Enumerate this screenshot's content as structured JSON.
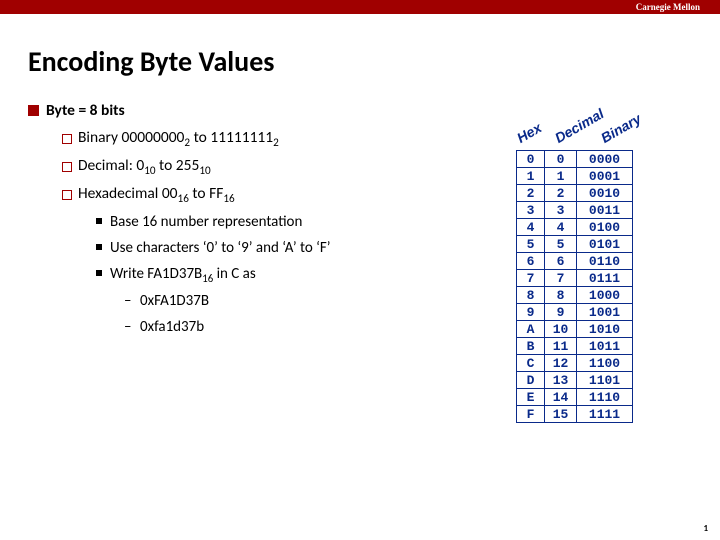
{
  "header": {
    "org": "Carnegie Mellon"
  },
  "title": "Encoding Byte Values",
  "bullets": {
    "byte": "Byte = 8 bits",
    "binary_pre": "Binary 00000000",
    "binary_sub1": "2",
    "binary_mid": " to 11111111",
    "binary_sub2": "2",
    "decimal_pre": "Decimal: 0",
    "decimal_sub1": "10",
    "decimal_mid": " to 255",
    "decimal_sub2": "10",
    "hex_pre": "Hexadecimal 00",
    "hex_sub1": "16",
    "hex_mid": " to FF",
    "hex_sub2": "16",
    "base16": "Base 16 number representation",
    "chars": "Use characters ‘0’ to ‘9’ and ‘A’ to ‘F’",
    "write_pre": "Write FA1D37B",
    "write_sub": "16",
    "write_post": " in C as",
    "ex1": "0xFA1D37B",
    "ex2": "0xfa1d37b"
  },
  "table_headers": {
    "hex": "Hex",
    "dec": "Decimal",
    "bin": "Binary"
  },
  "chart_data": {
    "type": "table",
    "title": "Hex / Decimal / Binary byte nibble values",
    "columns": [
      "Hex",
      "Decimal",
      "Binary"
    ],
    "rows": [
      [
        "0",
        "0",
        "0000"
      ],
      [
        "1",
        "1",
        "0001"
      ],
      [
        "2",
        "2",
        "0010"
      ],
      [
        "3",
        "3",
        "0011"
      ],
      [
        "4",
        "4",
        "0100"
      ],
      [
        "5",
        "5",
        "0101"
      ],
      [
        "6",
        "6",
        "0110"
      ],
      [
        "7",
        "7",
        "0111"
      ],
      [
        "8",
        "8",
        "1000"
      ],
      [
        "9",
        "9",
        "1001"
      ],
      [
        "A",
        "10",
        "1010"
      ],
      [
        "B",
        "11",
        "1011"
      ],
      [
        "C",
        "12",
        "1100"
      ],
      [
        "D",
        "13",
        "1101"
      ],
      [
        "E",
        "14",
        "1110"
      ],
      [
        "F",
        "15",
        "1111"
      ]
    ]
  },
  "page_number": "1"
}
